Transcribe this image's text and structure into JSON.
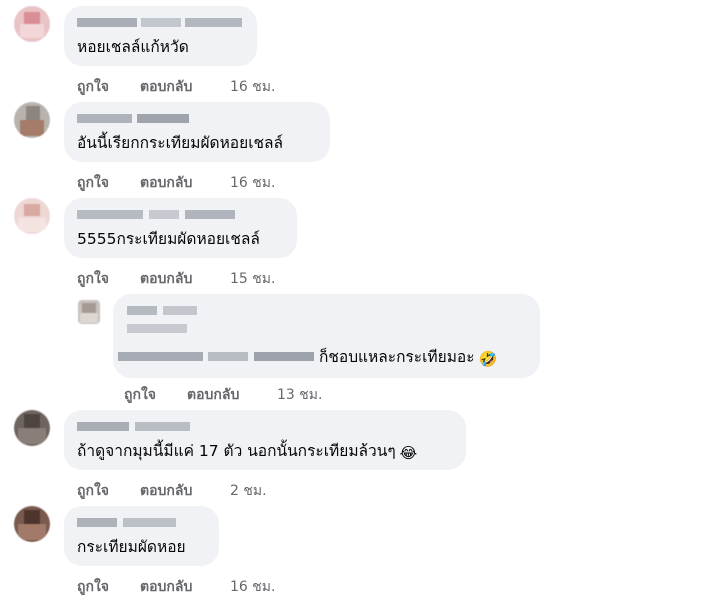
{
  "comments": [
    {
      "text": "หอยเชลล์แก้หวัด",
      "like": "ถูกใจ",
      "reply": "ตอบกลับ",
      "time": "16 ชม."
    },
    {
      "text": "อันนี้เรียกกระเทียมผัดหอยเชลล์",
      "like": "ถูกใจ",
      "reply": "ตอบกลับ",
      "time": "16 ชม."
    },
    {
      "text": "5555กระเทียมผัดหอยเชลล์",
      "like": "ถูกใจ",
      "reply": "ตอบกลับ",
      "time": "15 ชม."
    },
    {
      "text": "ก็ชอบแหละกระเทียมอะ",
      "emoji": "🤣",
      "like": "ถูกใจ",
      "reply": "ตอบกลับ",
      "time": "13 ชม."
    },
    {
      "text": "ถ้าดูจากมุมนี้มีแค่ 17 ตัว นอกนั้นกระเทียมล้วนๆ",
      "emoji": "😂",
      "like": "ถูกใจ",
      "reply": "ตอบกลับ",
      "time": "2 ชม."
    },
    {
      "text": "กระเทียมผัดหอย",
      "like": "ถูกใจ",
      "reply": "ตอบกลับ",
      "time": "16 ชม."
    }
  ],
  "colors": {
    "bubble": "#f0f2f5",
    "text": "#050505",
    "meta": "#65676b"
  }
}
